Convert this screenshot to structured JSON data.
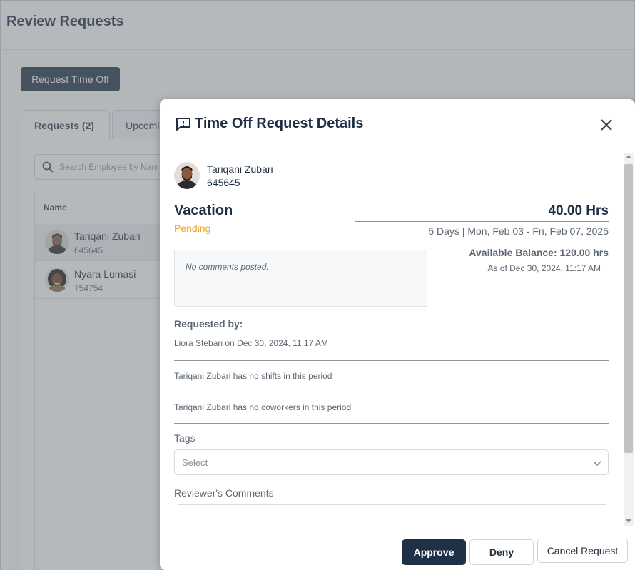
{
  "page": {
    "title": "Review Requests",
    "request_button": "Request Time Off",
    "tabs": [
      {
        "label": "Requests (2)"
      },
      {
        "label": "Upcomi"
      }
    ],
    "search_placeholder": "Search Employee by Nam",
    "list_header": "Name",
    "employees": [
      {
        "name": "Tariqani Zubari",
        "id": "645645"
      },
      {
        "name": "Nyara Lumasi",
        "id": "754754"
      }
    ]
  },
  "modal": {
    "title": "Time Off Request Details",
    "employee": {
      "name": "Tariqani Zubari",
      "id": "645645"
    },
    "request": {
      "type": "Vacation",
      "status": "Pending",
      "hours": "40.00 Hrs",
      "dates": "5 Days | Mon, Feb 03 - Fri, Feb 07, 2025"
    },
    "comments": "No comments posted.",
    "balance": "Available Balance: 120.00 hrs",
    "balance_asof": "As of Dec 30, 2024, 11:17 AM",
    "requested_by_label": "Requested by:",
    "requested_by": "Liora Steban on Dec 30, 2024, 11:17 AM",
    "shifts_note": "Tariqani Zubari has no shifts in this period",
    "coworkers_note": "Tariqani Zubari has no coworkers in this period",
    "tags_label": "Tags",
    "tags_placeholder": "Select",
    "reviewer_label": "Reviewer's Comments",
    "buttons": {
      "approve": "Approve",
      "deny": "Deny",
      "cancel": "Cancel Request"
    }
  },
  "colors": {
    "primary": "#1e3146",
    "pending": "#f0a521"
  }
}
